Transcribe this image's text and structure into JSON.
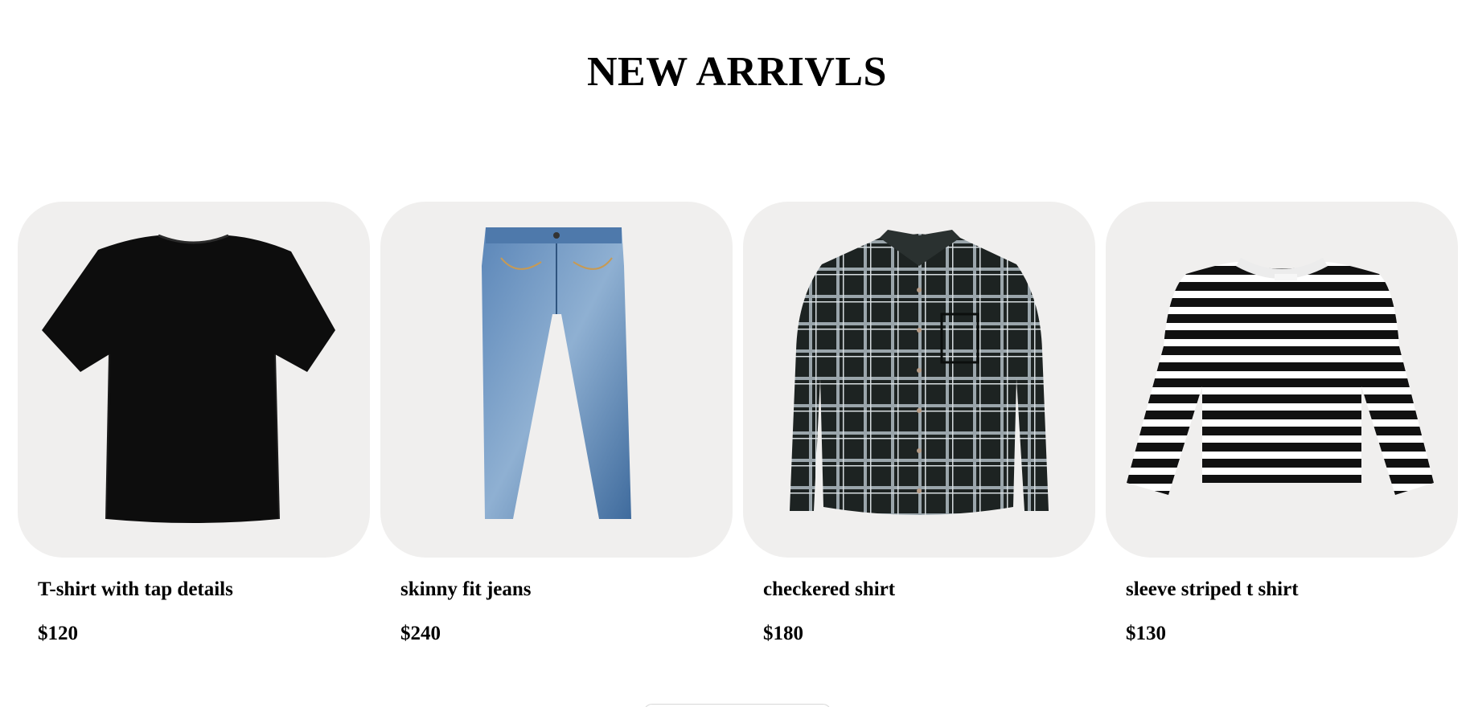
{
  "section": {
    "title": "NEW ARRIVLS"
  },
  "products": [
    {
      "name": "T-shirt with tap details",
      "price": "$120",
      "image_icon": "black-tshirt-image"
    },
    {
      "name": "skinny fit jeans",
      "price": "$240",
      "image_icon": "blue-jeans-image"
    },
    {
      "name": "checkered shirt",
      "price": "$180",
      "image_icon": "plaid-shirt-image"
    },
    {
      "name": "sleeve striped t shirt",
      "price": "$130",
      "image_icon": "striped-longsleeve-image"
    }
  ],
  "colors": {
    "card_background": "#f0efee",
    "text": "#000000"
  }
}
